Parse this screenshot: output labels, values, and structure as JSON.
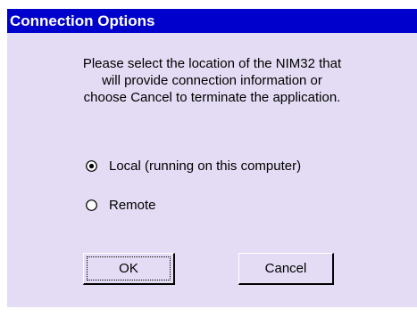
{
  "dialog": {
    "title": "Connection Options",
    "message_lines": [
      "Please select the location of the NIM32 that",
      "will provide connection information or",
      "choose Cancel to terminate the application."
    ],
    "options": [
      {
        "label": "Local (running on this computer)",
        "selected": true
      },
      {
        "label": "Remote",
        "selected": false
      }
    ],
    "ok_label": "OK",
    "cancel_label": "Cancel"
  }
}
